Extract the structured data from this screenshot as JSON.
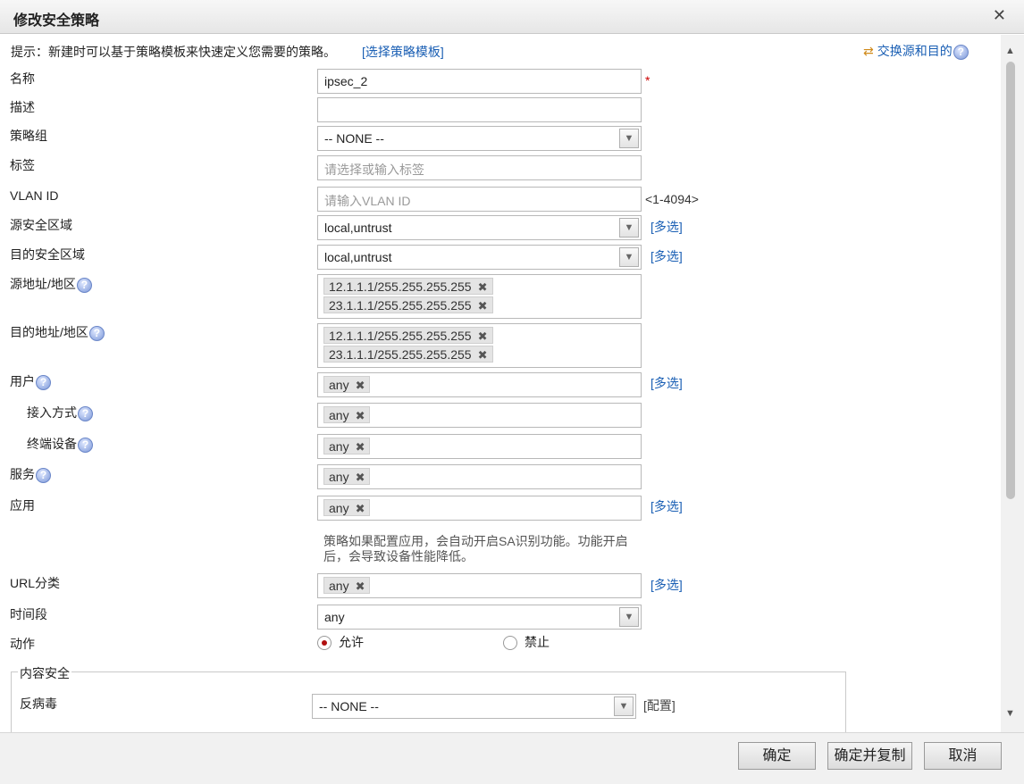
{
  "dialog": {
    "title": "修改安全策略",
    "close_label": "✕"
  },
  "tip": {
    "text": "提示：新建时可以基于策略模板来快速定义您需要的策略。",
    "link": "[选择策略模板]"
  },
  "swap_link": "交换源和目的",
  "fields": {
    "name": {
      "label": "名称",
      "value": "ipsec_2",
      "required_mark": "*"
    },
    "desc": {
      "label": "描述",
      "value": ""
    },
    "policy_group": {
      "label": "策略组",
      "value": "-- NONE --"
    },
    "tag": {
      "label": "标签",
      "placeholder": "请选择或输入标签"
    },
    "vlan": {
      "label": "VLAN ID",
      "placeholder": "请输入VLAN ID",
      "range": "<1-4094>"
    },
    "src_zone": {
      "label": "源安全区域",
      "value": "local,untrust",
      "link": "[多选]"
    },
    "dst_zone": {
      "label": "目的安全区域",
      "value": "local,untrust",
      "link": "[多选]"
    },
    "src_addr": {
      "label": "源地址/地区",
      "tags": [
        "12.1.1.1/255.255.255.255",
        "23.1.1.1/255.255.255.255"
      ]
    },
    "dst_addr": {
      "label": "目的地址/地区",
      "tags": [
        "12.1.1.1/255.255.255.255",
        "23.1.1.1/255.255.255.255"
      ]
    },
    "user": {
      "label": "用户",
      "tag": "any",
      "link": "[多选]"
    },
    "access": {
      "label": "接入方式",
      "tag": "any"
    },
    "terminal": {
      "label": "终端设备",
      "tag": "any"
    },
    "service": {
      "label": "服务",
      "tag": "any"
    },
    "app": {
      "label": "应用",
      "tag": "any",
      "link": "[多选]",
      "hint_line1": "策略如果配置应用，会自动开启SA识别功能。功能开启",
      "hint_line2": "后，会导致设备性能降低。"
    },
    "url": {
      "label": "URL分类",
      "tag": "any",
      "link": "[多选]"
    },
    "time": {
      "label": "时间段",
      "value": "any"
    },
    "action": {
      "label": "动作",
      "allow": "允许",
      "deny": "禁止",
      "selected": "允许"
    }
  },
  "content_security": {
    "legend": "内容安全",
    "antivirus": {
      "label": "反病毒",
      "value": "-- NONE --",
      "link": "[配置]"
    }
  },
  "help_glyph": "?",
  "tag_remove_glyph": "✖",
  "select_arrow_glyph": "▼",
  "buttons": {
    "ok": "确定",
    "ok_copy": "确定并复制",
    "cancel": "取消"
  },
  "colors": {
    "link": "#1a5fb4",
    "required": "#cc0000",
    "radio_selected": "#b01010"
  }
}
